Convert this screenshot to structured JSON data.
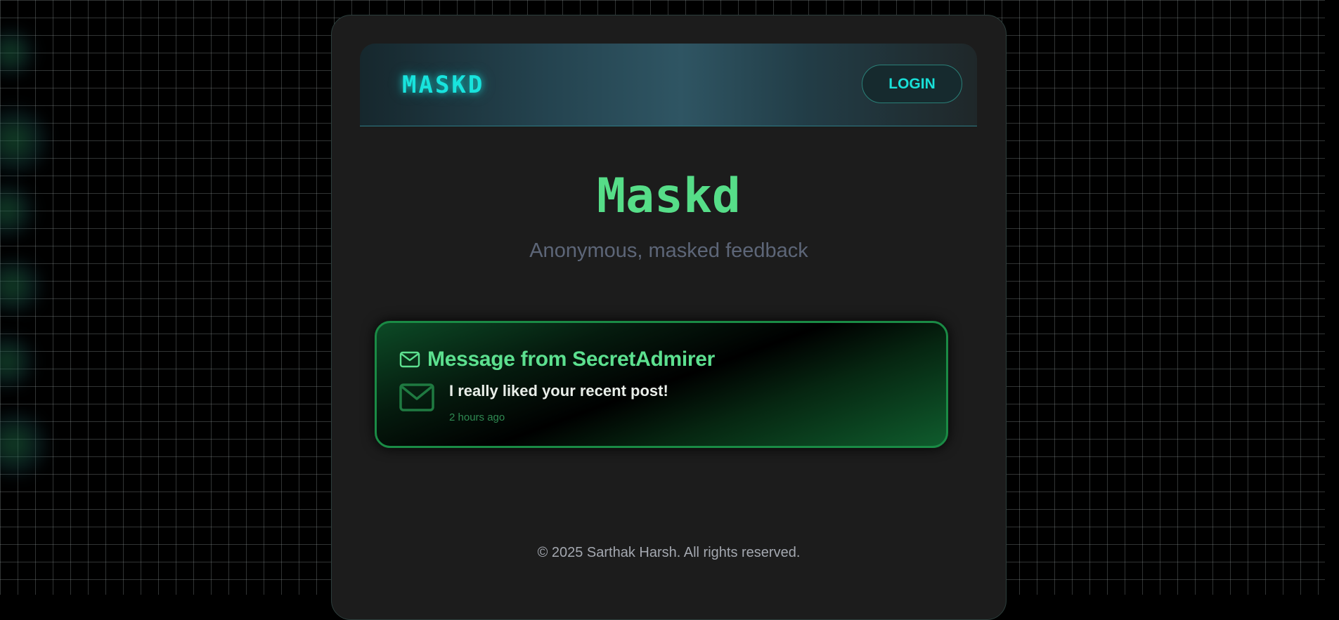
{
  "navbar": {
    "brand": "MASKD",
    "login_label": "LOGIN"
  },
  "hero": {
    "title": "Maskd",
    "subtitle": "Anonymous, masked feedback"
  },
  "message": {
    "icon": "mail-icon",
    "title": "Message from SecretAdmirer",
    "body_icon": "mail-icon",
    "text": "I really liked your recent post!",
    "time": "2 hours ago"
  },
  "footer": {
    "copyright": "© 2025 Sarthak Harsh. All rights reserved."
  },
  "colors": {
    "background": "#000000",
    "card": "#1c1c1c",
    "brand_cyan": "#18e3dd",
    "accent_green": "#56dd88",
    "subtitle_gray": "#5d6678",
    "time_green": "#2f8a52"
  }
}
